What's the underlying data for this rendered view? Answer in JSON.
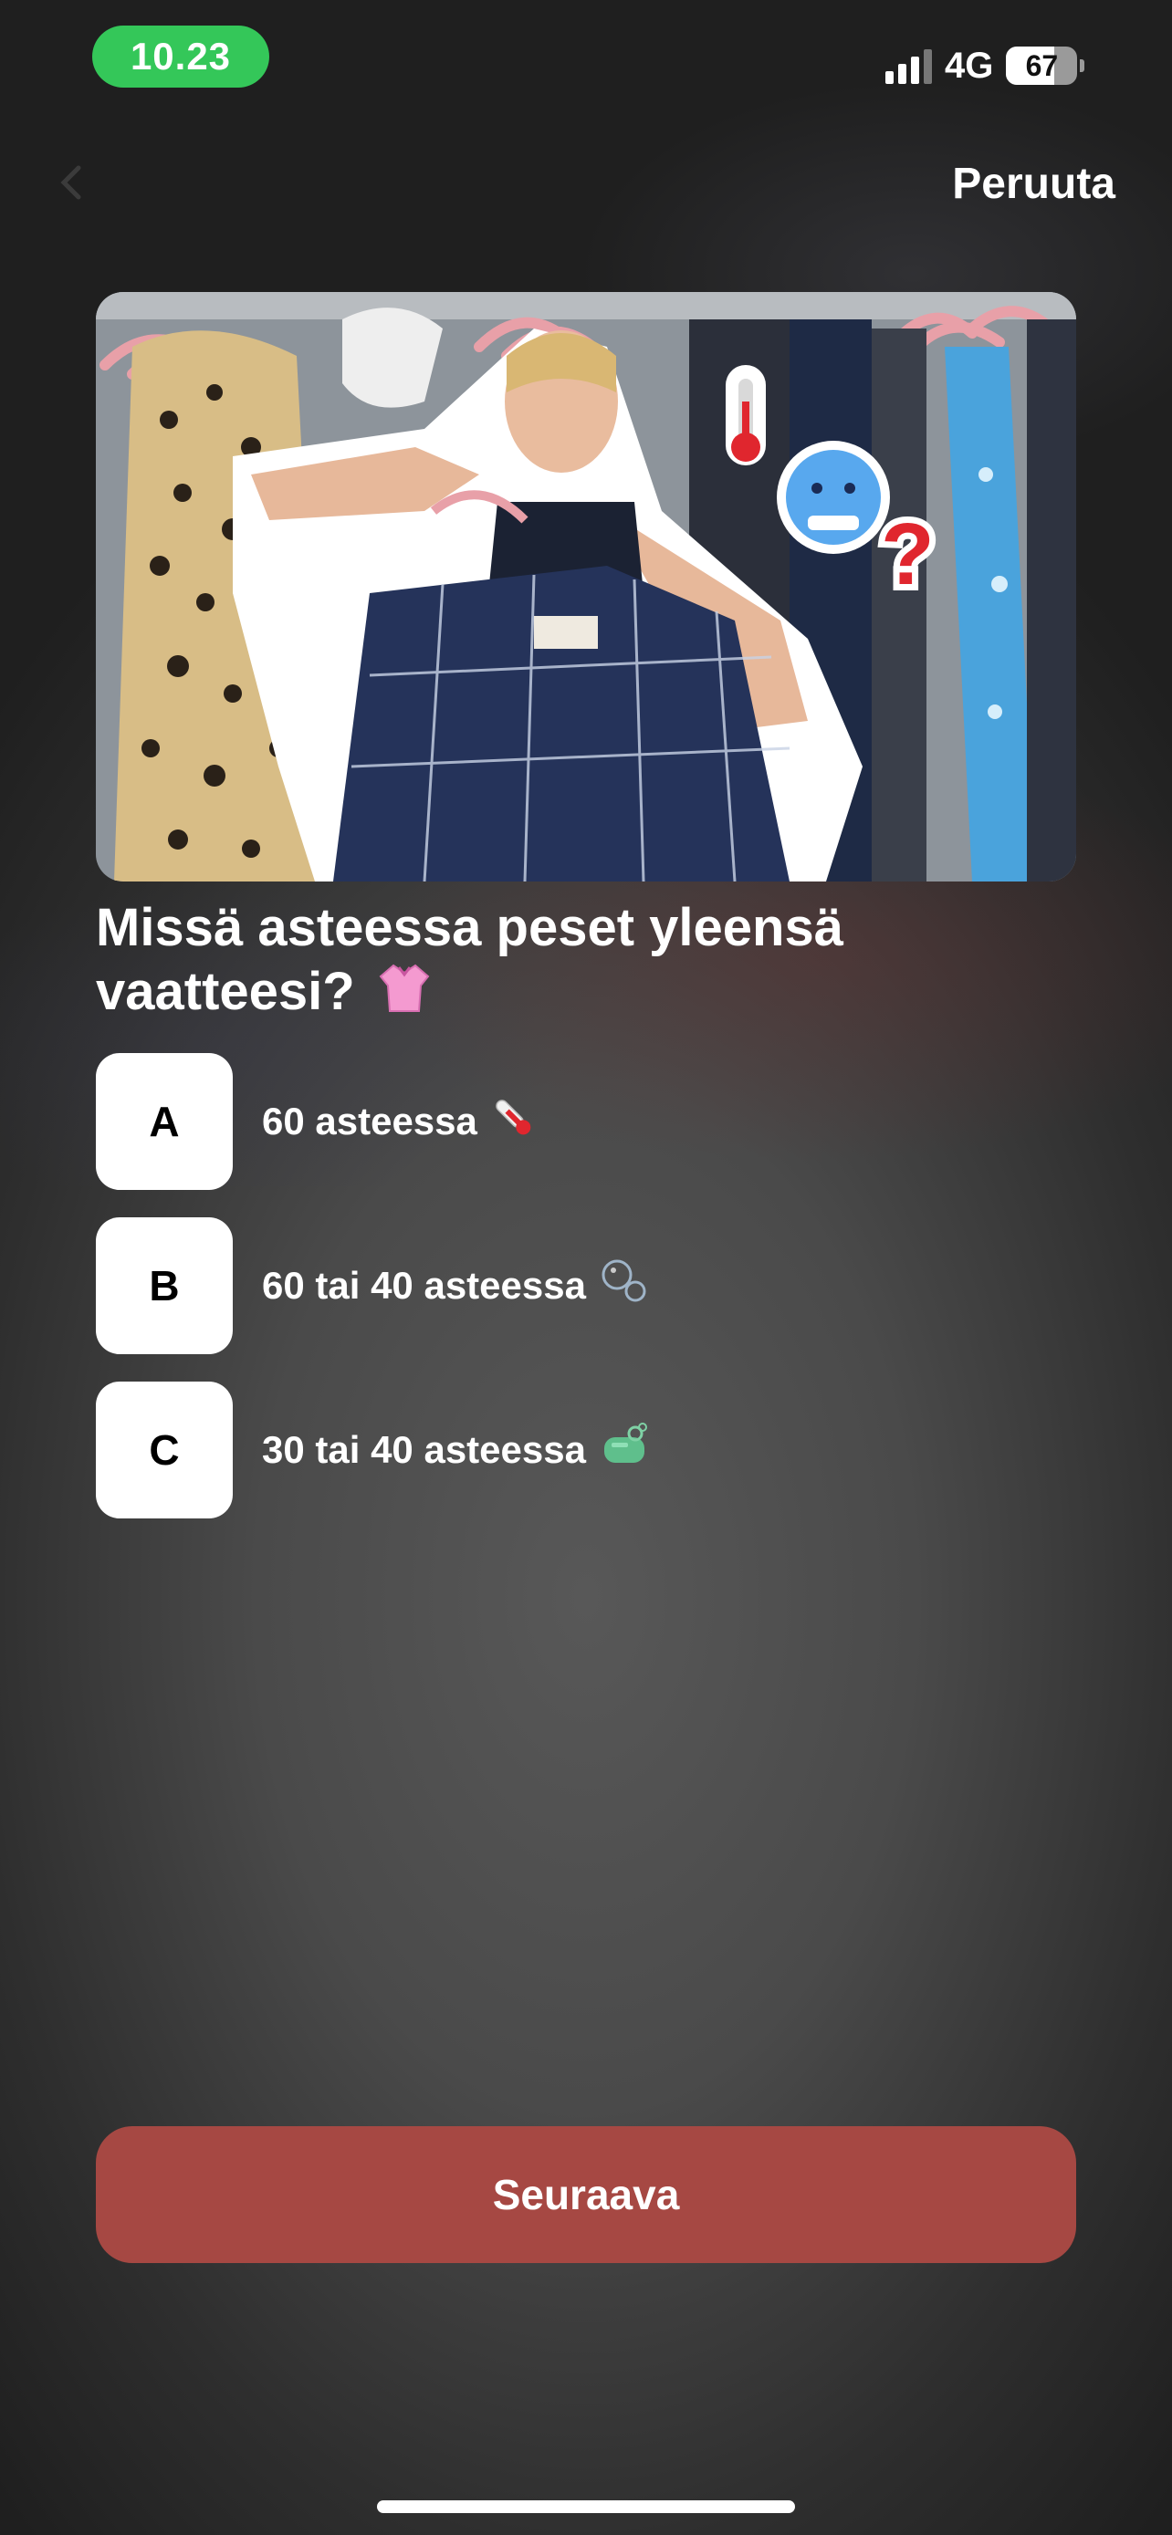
{
  "status_bar": {
    "time": "10.23",
    "network": "4G",
    "battery": "67",
    "battery_level": 0.67
  },
  "nav": {
    "back_icon": "chevron-left-icon",
    "cancel_label": "Peruuta"
  },
  "hero": {
    "image_icon": "quiz-hero-image"
  },
  "question": {
    "text": "Missä asteessa peset yleensä vaatteesi?",
    "emoji": "shirt-icon"
  },
  "answers": [
    {
      "letter": "A",
      "label": "60 asteessa",
      "emoji": "thermometer-icon"
    },
    {
      "letter": "B",
      "label": "60 tai 40 asteessa",
      "emoji": "bubbles-icon"
    },
    {
      "letter": "C",
      "label": "30 tai 40 asteessa",
      "emoji": "soap-icon"
    }
  ],
  "footer": {
    "next_label": "Seuraava"
  },
  "colors": {
    "accent_green": "#34c759",
    "button_red": "#a64843",
    "background": "#2a2a2a"
  }
}
